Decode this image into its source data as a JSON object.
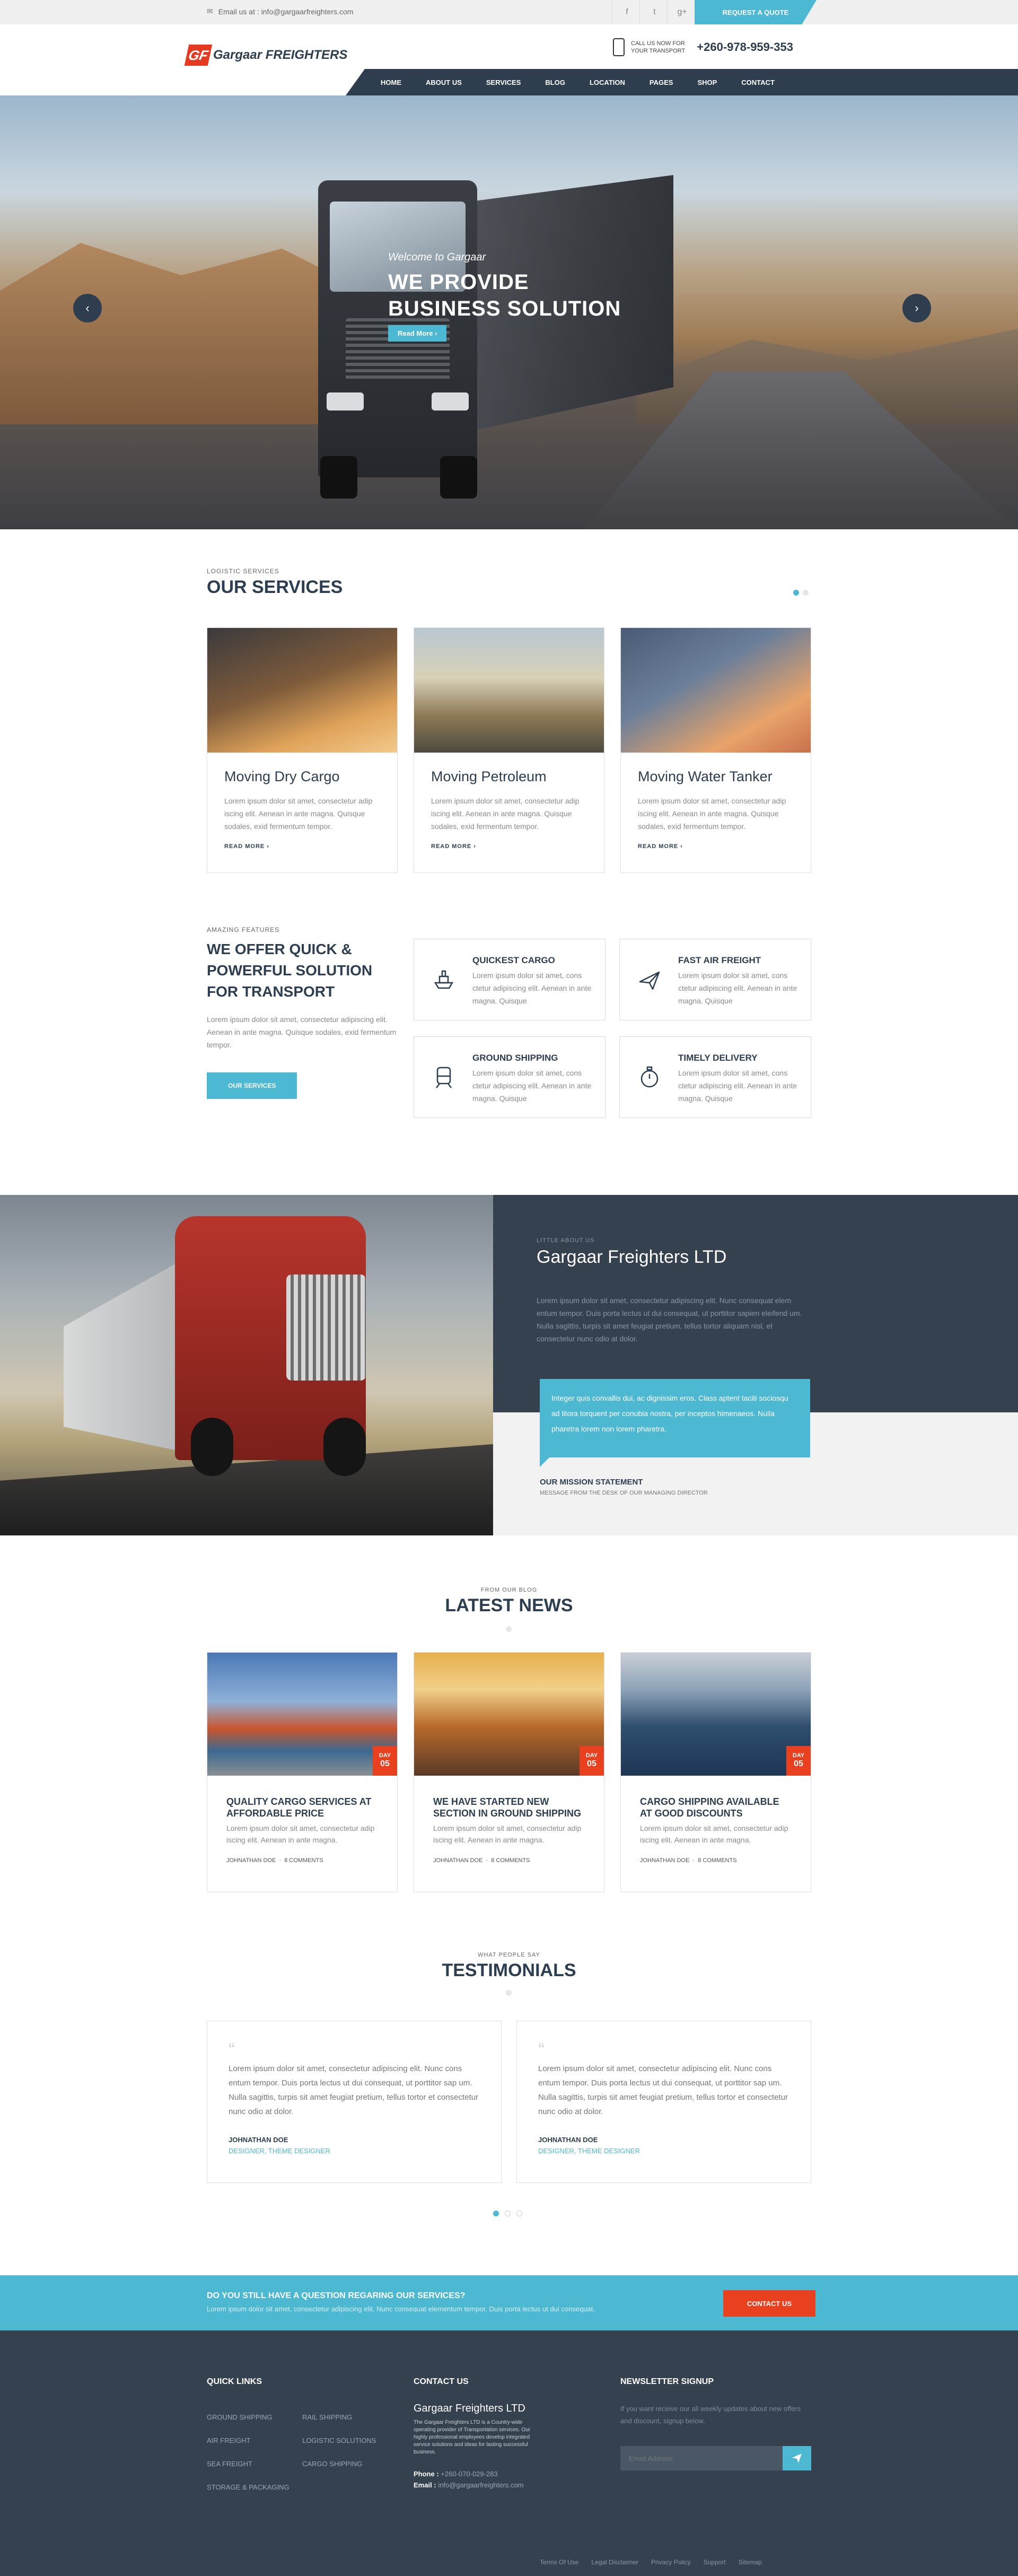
{
  "topbar": {
    "email_label": "Email us at : info@gargaarfreighters.com",
    "social": [
      "f",
      "t",
      "g+"
    ],
    "quote_button": "REQUEST A QUOTE"
  },
  "header": {
    "logo_mark": "GF",
    "logo_name": "Gargaar FREIGHTERS",
    "call_line1": "CALL US NOW FOR",
    "call_line2": "YOUR TRANSPORT",
    "phone": "+260-978-959-353"
  },
  "nav": {
    "items": [
      "HOME",
      "ABOUT US",
      "SERVICES",
      "BLOG",
      "LOCATION",
      "PAGES",
      "SHOP",
      "CONTACT"
    ]
  },
  "hero": {
    "welcome": "Welcome to Gargaar",
    "title_line1": "WE PROVIDE",
    "title_line2": "BUSINESS SOLUTION",
    "button": "Read More",
    "prev": "‹",
    "next": "›"
  },
  "services": {
    "kicker": "LOGISTIC SERVICES",
    "title": "OUR SERVICES",
    "cards": [
      {
        "title": "Moving Dry Cargo",
        "text": "Lorem ipsum dolor sit amet, consectetur adip iscing elit. Aenean in ante magna. Quisque sodales, exid fermentum tempor.",
        "link": "READ MORE"
      },
      {
        "title": "Moving Petroleum",
        "text": "Lorem ipsum dolor sit amet, consectetur adip iscing elit. Aenean in ante magna. Quisque sodales, exid fermentum tempor.",
        "link": "READ MORE"
      },
      {
        "title": "Moving Water Tanker",
        "text": "Lorem ipsum dolor sit amet, consectetur adip iscing elit. Aenean in ante magna. Quisque sodales, exid fermentum tempor.",
        "link": "READ MORE"
      }
    ]
  },
  "features": {
    "kicker": "AMAZING FEATURES",
    "title_line1": "WE OFFER QUICK &",
    "title_line2": "POWERFUL SOLUTION",
    "title_line3": "FOR TRANSPORT",
    "text": "Lorem ipsum dolor sit amet, consectetur adipiscing elit. Aenean in ante magna. Quisque sodales, exid fermentum tempor.",
    "button": "OUR SERVICES",
    "items": [
      {
        "title": "QUICKEST CARGO",
        "text": "Lorem ipsum dolor sit amet, cons ctetur adipiscing elit. Aenean in ante magna. Quisque"
      },
      {
        "title": "FAST AIR FREIGHT",
        "text": "Lorem ipsum dolor sit amet, cons ctetur adipiscing elit. Aenean in ante magna. Quisque"
      },
      {
        "title": "GROUND SHIPPING",
        "text": "Lorem ipsum dolor sit amet, cons ctetur adipiscing elit. Aenean in ante magna. Quisque"
      },
      {
        "title": "TIMELY DELIVERY",
        "text": "Lorem ipsum dolor sit amet, cons ctetur adipiscing elit. Aenean in ante magna. Quisque"
      }
    ]
  },
  "about": {
    "kicker": "LITTLE ABOUT US",
    "title": "Gargaar Freighters LTD",
    "text": "Lorem ipsum dolor sit amet, consectetur adipiscing elit. Nunc consequat elem entum tempor. Duis porta lectus ut dui consequat, ut porttitor sapien eleifend um. Nulla sagittis, turpis sit amet feugiat pretium, tellus tortor aliquam nisl, et consectetur nunc odio at dolor.",
    "quote": "Integer quis convallis dui, ac dignissim eros. Class aptent taciti sociosqu ad litora torquent per conubia nostra, per inceptos himenaeos. Nulla pharetra lorem non lorem pharetra.",
    "mission_title": "OUR MISSION STATEMENT",
    "mission_sub": "MESSAGE FROM THE DESK OF OUR MANAGING DIRECTOR"
  },
  "news": {
    "kicker": "FROM OUR BLOG",
    "title": "LATEST NEWS",
    "items": [
      {
        "title": "QUALITY CARGO SERVICES AT AFFORDABLE PRICE",
        "text": "Lorem ipsum dolor sit amet, consectetur adip iscing elit. Aenean in ante magna.",
        "author": "JOHNATHAN DOE",
        "comments": "8 COMMENTS",
        "month": "DAY",
        "day": "05"
      },
      {
        "title": "WE HAVE STARTED NEW SECTION IN GROUND SHIPPING",
        "text": "Lorem ipsum dolor sit amet, consectetur adip iscing elit. Aenean in ante magna.",
        "author": "JOHNATHAN DOE",
        "comments": "8 COMMENTS",
        "month": "DAY",
        "day": "05"
      },
      {
        "title": "CARGO SHIPPING AVAILABLE AT GOOD DISCOUNTS",
        "text": "Lorem ipsum dolor sit amet, consectetur adip iscing elit. Aenean in ante magna.",
        "author": "JOHNATHAN DOE",
        "comments": "8 COMMENTS",
        "month": "DAY",
        "day": "05"
      }
    ]
  },
  "testimonials": {
    "kicker": "WHAT PEOPLE SAY",
    "title": "TESTIMONIALS",
    "items": [
      {
        "text": "Lorem ipsum dolor sit amet, consectetur adipiscing elit. Nunc cons entum tempor. Duis porta lectus ut dui consequat, ut porttitor sap um. Nulla sagittis, turpis sit amet feugiat pretium, tellus tortor et consectetur nunc odio at dolor.",
        "name": "JOHNATHAN DOE",
        "role": "DESIGNER, THEME DESIGNER"
      },
      {
        "text": "Lorem ipsum dolor sit amet, consectetur adipiscing elit. Nunc cons entum tempor. Duis porta lectus ut dui consequat, ut porttitor sap um. Nulla sagittis, turpis sit amet feugiat pretium, tellus tortor et consectetur nunc odio at dolor.",
        "name": "JOHNATHAN DOE",
        "role": "DESIGNER, THEME DESIGNER"
      }
    ]
  },
  "cta": {
    "title": "DO YOU STILL HAVE A QUESTION REGARING OUR SERVICES?",
    "text": "Lorem ipsum dolor sit amet, consectetur adipiscing elit. Nunc consequat elementum tempor. Duis porta lectus ut dui consequat.",
    "button": "CONTACT US"
  },
  "footer": {
    "quick_title": "QUICK LINKS",
    "links_col1": [
      "GROUND SHIPPING",
      "AIR FREIGHT",
      "SEA FREIGHT",
      "STORAGE & PACKAGING"
    ],
    "links_col2": [
      "RAIL SHIPPING",
      "LOGISTIC SOLUTIONS",
      "CARGO SHIPPING"
    ],
    "contact_title": "CONTACT US",
    "company": "Gargaar Freighters LTD",
    "company_text": "The Gargaar Freighters LTD is a Country-wide operating provider of Transportation services. Our highly professional employees develop integrated service solutions and ideas for lasting successful business.",
    "phone_label": "Phone :",
    "phone": "+260-070-029-283",
    "email_label": "Email :",
    "email": "info@gargaarfreighters.com",
    "newsletter_title": "NEWSLETTER SIGNUP",
    "newsletter_text": "If you want receive our all weekly updates about new offers and discount, signup below.",
    "newsletter_placeholder": "Email Address",
    "bottom_links": [
      "Terms Of Use",
      "Legal Disclaimer",
      "Privacy Policy",
      "Support",
      "Sitemap"
    ]
  }
}
